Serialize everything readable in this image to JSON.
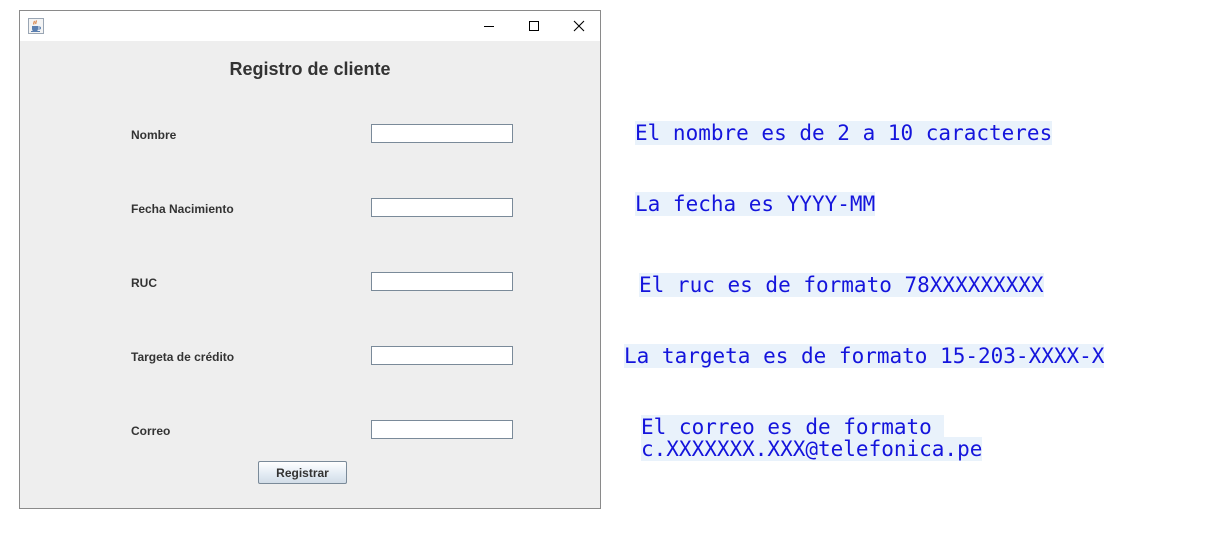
{
  "window": {
    "title_bar": {
      "app_icon": "java-cup-icon",
      "buttons": [
        "minimize-icon",
        "maximize-icon",
        "close-icon"
      ]
    },
    "form": {
      "title": "Registro de cliente",
      "fields": {
        "nombre": {
          "label": "Nombre",
          "value": ""
        },
        "fecha": {
          "label": "Fecha Nacimiento",
          "value": ""
        },
        "ruc": {
          "label": "RUC",
          "value": ""
        },
        "tarjeta": {
          "label": "Targeta de crédito",
          "value": ""
        },
        "correo": {
          "label": "Correo",
          "value": ""
        }
      },
      "submit_label": "Registrar"
    }
  },
  "notes": {
    "nombre": "El nombre es de 2 a 10 caracteres",
    "fecha": "La fecha es YYYY-MM",
    "ruc": "El ruc es de formato 78XXXXXXXXX",
    "tarjeta": "La targeta es de formato 15-203-XXXX-X",
    "correo_line1": "El correo es de formato ",
    "correo_line2": "c.XXXXXXX.XXX@telefonica.pe"
  },
  "colors": {
    "note_text": "#1414dc",
    "note_highlight": "#e9f2fb",
    "window_bg": "#eeeeee"
  }
}
